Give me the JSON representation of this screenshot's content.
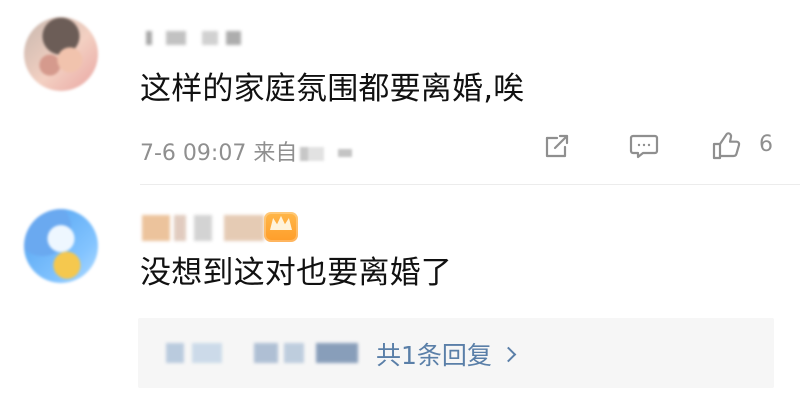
{
  "comments": [
    {
      "text": "这样的家庭氛围都要离婚,唉",
      "meta": {
        "time": "7-6 09:07",
        "source_prefix": "来自"
      },
      "actions": {
        "like_count": "6",
        "icons": [
          "share-icon",
          "comment-icon",
          "thumb-up-icon"
        ]
      }
    },
    {
      "text": "没想到这对也要离婚了",
      "badge_icon": "crown-badge-icon",
      "reply_summary": {
        "label": "共1条回复"
      }
    }
  ],
  "colors": {
    "meta": "#8f8f8f",
    "reply_link": "#5a7fa8",
    "reply_box": "#f6f6f6"
  }
}
